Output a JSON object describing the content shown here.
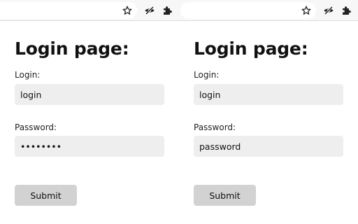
{
  "panes": [
    {
      "title": "Login page:",
      "login_label": "Login:",
      "login_value": "login",
      "password_label": "Password:",
      "password_value": "password",
      "password_input_type": "password",
      "submit_label": "Submit"
    },
    {
      "title": "Login page:",
      "login_label": "Login:",
      "login_value": "login",
      "password_label": "Password:",
      "password_value": "password",
      "password_input_type": "text",
      "submit_label": "Submit"
    }
  ],
  "toolbar": {
    "icons": [
      "star-icon",
      "eye-off-icon",
      "puzzle-icon"
    ]
  },
  "colors": {
    "input_background": "#eeeeee",
    "button_background": "#d2d2d2",
    "toolbar_background": "#f7f7f7"
  }
}
